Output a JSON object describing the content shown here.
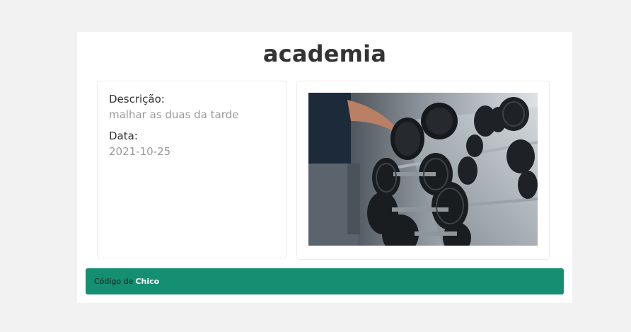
{
  "page": {
    "title": "academia"
  },
  "details": {
    "description_label": "Descrição:",
    "description_value": "malhar as duas da tarde",
    "date_label": "Data:",
    "date_value": "2021-10-25"
  },
  "image": {
    "subject": "dumbbell-rack-photo"
  },
  "footer": {
    "prefix": "Código de",
    "author": "Chico"
  },
  "colors": {
    "background": "#f2f2f2",
    "card": "#ffffff",
    "footer": "#148f72",
    "value_text": "#9a9a9a"
  }
}
